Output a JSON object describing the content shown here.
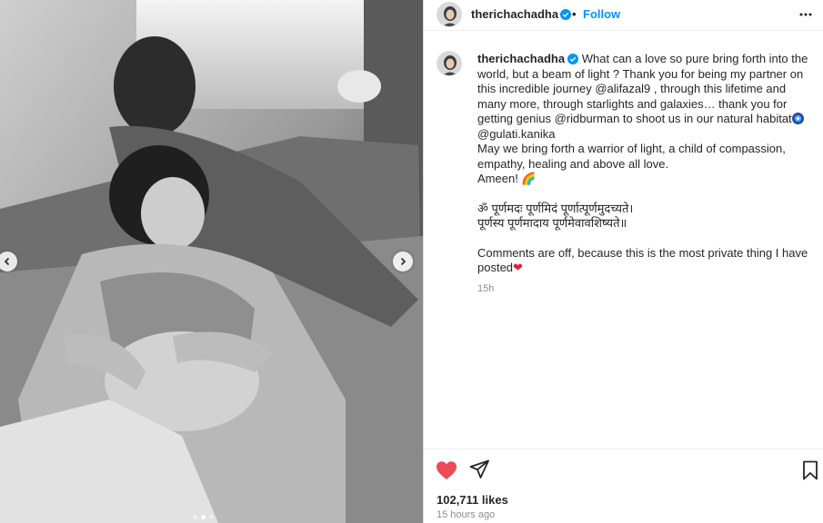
{
  "post": {
    "username": "therichachadha",
    "separator": "•",
    "follow_label": "Follow",
    "caption": {
      "line1_a": "What can a love so pure bring forth into the world, but a beam of light ? Thank you for being my partner on this incredible journey ",
      "mention1": "@alifazal9",
      "line1_b": " , through this lifetime and many more, through starlights and galaxies… thank you for getting genius ",
      "mention2": "@ridburman",
      "line1_c": " to shoot us in our natural habitat",
      "mention3": "@gulati.kanika",
      "line2": "May we bring forth a warrior of light, a child of compassion, empathy, healing and above all love.",
      "line3": "Ameen! 🌈",
      "sanskrit1": "ॐ पूर्णमदः पूर्णमिदं पूर्णात्पूर्णमुदच्यते।",
      "sanskrit2": "पूर्णस्य पूर्णमादाय पूर्णमेवावशिष्यते॥",
      "note": "Comments are off, because this is the most private thing I have posted",
      "heart": "❤",
      "time": "15h"
    },
    "likes": "102,711 likes",
    "posted_ago": "15 hours ago",
    "carousel": {
      "slides": 3,
      "active_index": 1
    }
  },
  "icons": {
    "verified": "verified-badge-icon",
    "more": "more-options-icon",
    "like": "heart-filled-icon",
    "share": "paper-plane-icon",
    "save": "bookmark-icon",
    "prev": "chevron-left-icon",
    "next": "chevron-right-icon"
  },
  "colors": {
    "accent_blue": "#0095f6",
    "like_red": "#ed4956",
    "verified_blue": "#0095f6"
  }
}
